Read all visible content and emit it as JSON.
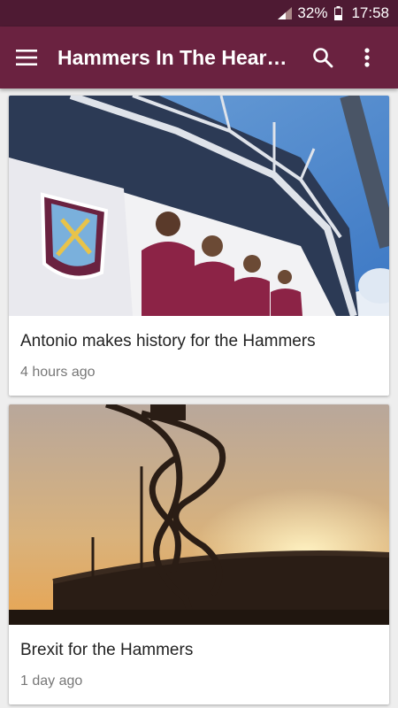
{
  "status_bar": {
    "battery": "32%",
    "time": "17:58"
  },
  "app_bar": {
    "title": "Hammers In The Hear…",
    "menu_icon": "hamburger-menu-icon",
    "search_icon": "search-icon",
    "more_icon": "more-vert-icon"
  },
  "colors": {
    "status_bar": "#4e1a33",
    "app_bar": "#6a2240",
    "background": "#eeeeee"
  },
  "articles": [
    {
      "title": "Antonio makes history for the Hammers",
      "time": "4 hours ago",
      "image": "stadium-exterior-photo"
    },
    {
      "title": "Brexit for the Hammers",
      "time": "1 day ago",
      "image": "orbit-tower-sunset-photo"
    }
  ]
}
